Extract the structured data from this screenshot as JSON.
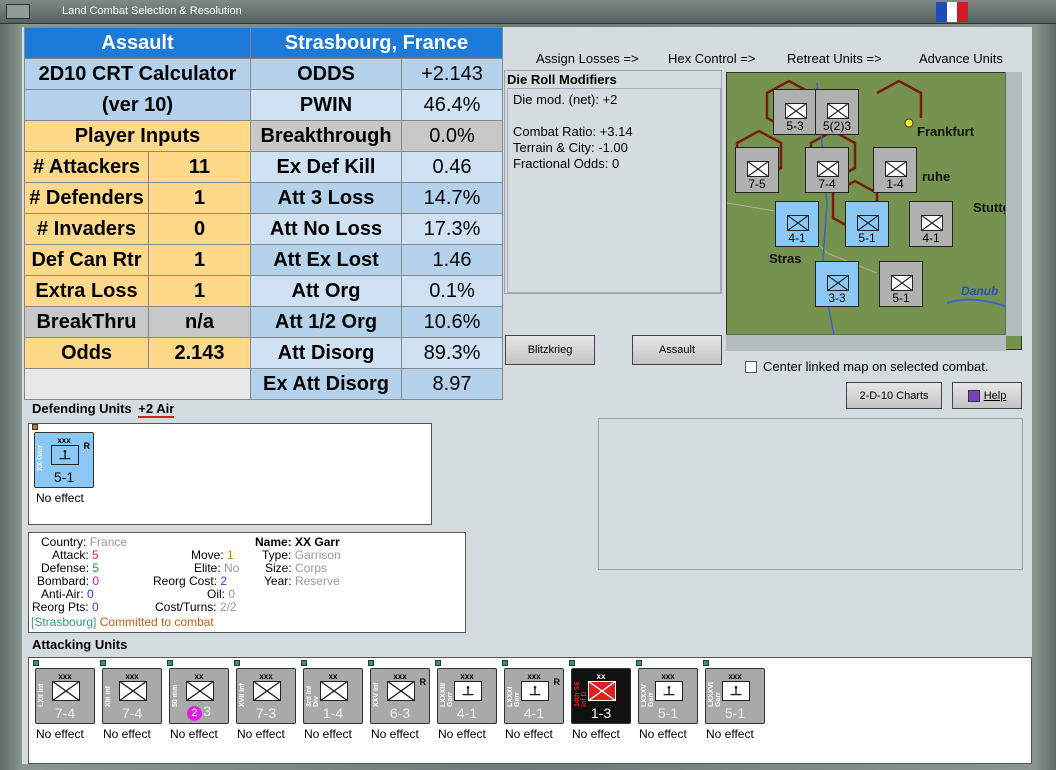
{
  "window": {
    "title": "Land Combat Selection & Resolution"
  },
  "colors": {
    "flag": [
      "#1e4db5",
      "#ffffff",
      "#d31b28"
    ]
  },
  "crt": {
    "left": [
      {
        "label": "Assault",
        "style": "c-blue",
        "span": 2
      },
      {
        "label": "2D10 CRT Calculator",
        "style": "c-lb",
        "span": 2
      },
      {
        "label": "(ver 10)",
        "style": "c-lb",
        "span": 2
      },
      {
        "label": "Player Inputs",
        "style": "c-y",
        "span": 2
      },
      {
        "label": "# Attackers",
        "value": "11",
        "style": "c-y"
      },
      {
        "label": "# Defenders",
        "value": "1",
        "style": "c-y"
      },
      {
        "label": "# Invaders",
        "value": "0",
        "style": "c-y"
      },
      {
        "label": "Def Can Rtr",
        "value": "1",
        "style": "c-y"
      },
      {
        "label": "Extra Loss",
        "value": "1",
        "style": "c-y"
      },
      {
        "label": "BreakThru",
        "value": "n/a",
        "style": "c-g"
      },
      {
        "label": "Odds",
        "value": "2.143",
        "style": "c-y"
      },
      {
        "label": "",
        "style": "c-w",
        "span": 2
      }
    ],
    "right": [
      {
        "label": "Strasbourg, France",
        "style": "c-blue",
        "span": 2
      },
      {
        "label": "ODDS",
        "value": "+2.143",
        "style": "c-lb"
      },
      {
        "label": "PWIN",
        "value": "46.4%",
        "style": "c-lb2"
      },
      {
        "label": "Breakthrough",
        "value": "0.0%",
        "style": "c-g"
      },
      {
        "label": "Ex Def Kill",
        "value": "0.46",
        "style": "c-lb2"
      },
      {
        "label": "Att 3 Loss",
        "value": "14.7%",
        "style": "c-lb"
      },
      {
        "label": "Att No Loss",
        "value": "17.3%",
        "style": "c-lb2"
      },
      {
        "label": "Att Ex Lost",
        "value": "1.46",
        "style": "c-lb"
      },
      {
        "label": "Att Org",
        "value": "0.1%",
        "style": "c-lb2"
      },
      {
        "label": "Att 1/2 Org",
        "value": "10.6%",
        "style": "c-lb"
      },
      {
        "label": "Att Disorg",
        "value": "89.3%",
        "style": "c-lb2"
      },
      {
        "label": "Ex Att Disorg",
        "value": "8.97",
        "style": "c-lb"
      }
    ]
  },
  "phases": [
    "Assign Losses =>",
    "Hex Control =>",
    "Retreat Units =>",
    "Advance Units"
  ],
  "die_roll": {
    "title": "Die Roll Modifiers",
    "text": "Die mod. (net): +2\n\nCombat Ratio: +3.14\nTerrain & City: -1.00\nFractional Odds: 0"
  },
  "buttons": {
    "blitzkrieg": "Blitzkrieg",
    "assault": "Assault",
    "charts": "2-D-10 Charts",
    "help": "Help"
  },
  "center_map_label": "Center linked map on selected combat.",
  "map": {
    "labels": [
      "Frankfurt",
      "Stuttga",
      "Stras",
      "Danub",
      "ruhe"
    ],
    "counters": [
      {
        "top": "5-3",
        "type": "grey"
      },
      {
        "top": "5(2)3",
        "type": "grey"
      },
      {
        "top": "7-5",
        "type": "grey"
      },
      {
        "top": "7-4",
        "type": "grey"
      },
      {
        "top": "1-4",
        "type": "grey"
      },
      {
        "top": "4-1",
        "type": "blue"
      },
      {
        "top": "5-1",
        "type": "blue"
      },
      {
        "top": "4-1",
        "type": "grey"
      },
      {
        "top": "3-3",
        "type": "blue"
      },
      {
        "top": "5-1",
        "type": "grey"
      }
    ]
  },
  "defending": {
    "title": "Defending Units",
    "air": "+2 Air",
    "units": [
      {
        "name": "XX Garr",
        "size": "xxx",
        "value": "5-1",
        "status": "No effect",
        "type": "blue",
        "r": "R"
      }
    ]
  },
  "info": {
    "country_label": "Country:",
    "country": "France",
    "attack_label": "Attack:",
    "attack": "5",
    "defense_label": "Defense:",
    "defense": "5",
    "bombard_label": "Bombard:",
    "bombard": "0",
    "antiair_label": "Anti-Air:",
    "antiair": "0",
    "reorgpts_label": "Reorg Pts:",
    "reorgpts": "0",
    "move_label": "Move:",
    "move": "1",
    "elite_label": "Elite:",
    "elite": "No",
    "reorgcost_label": "Reorg Cost:",
    "reorgcost": "2",
    "oil_label": "Oil:",
    "oil": "0",
    "costturns_label": "Cost/Turns:",
    "costturns": "2/2",
    "name_label": "Name:",
    "name": "XX Garr",
    "type_label": "Type:",
    "type": "Garrison",
    "size_label": "Size:",
    "size": "Corps",
    "year_label": "Year:",
    "year": "Reserve",
    "location": "[Strasbourg]",
    "status": "Committed to combat"
  },
  "attacking": {
    "title": "Attacking Units",
    "units": [
      {
        "name": "LXII Inf",
        "size": "xxx",
        "value": "7-4",
        "status": "No effect",
        "type": "grey",
        "r": ""
      },
      {
        "name": "XIII Inf",
        "size": "xxx",
        "value": "7-4",
        "status": "No effect",
        "type": "grey",
        "r": ""
      },
      {
        "name": "50 mm",
        "size": "xx",
        "value": "3",
        "badge": "2",
        "status": "No effect",
        "type": "grey",
        "r": ""
      },
      {
        "name": "XVII Inf",
        "size": "xxx",
        "value": "7-3",
        "status": "No effect",
        "type": "grey",
        "r": ""
      },
      {
        "name": "3rd Inf Div",
        "size": "xx",
        "value": "1-4",
        "status": "No effect",
        "type": "grey",
        "r": ""
      },
      {
        "name": "XXV Inf",
        "size": "xxx",
        "value": "6-3",
        "status": "No effect",
        "type": "grey",
        "r": "R"
      },
      {
        "name": "LXXXIII Garr",
        "size": "xxx",
        "value": "4-1",
        "status": "No effect",
        "type": "grey",
        "r": ""
      },
      {
        "name": "LXXXI Garr",
        "size": "xxx",
        "value": "4-1",
        "status": "No effect",
        "type": "grey",
        "r": "R"
      },
      {
        "name": "14th SS Inf D",
        "size": "xx",
        "value": "1-3",
        "status": "No effect",
        "type": "black",
        "r": ""
      },
      {
        "name": "LXXXV Garr",
        "size": "xxx",
        "value": "5-1",
        "status": "No effect",
        "type": "grey",
        "r": ""
      },
      {
        "name": "LXXXVI Garr",
        "size": "xxx",
        "value": "5-1",
        "status": "No effect",
        "type": "grey",
        "r": ""
      }
    ]
  }
}
